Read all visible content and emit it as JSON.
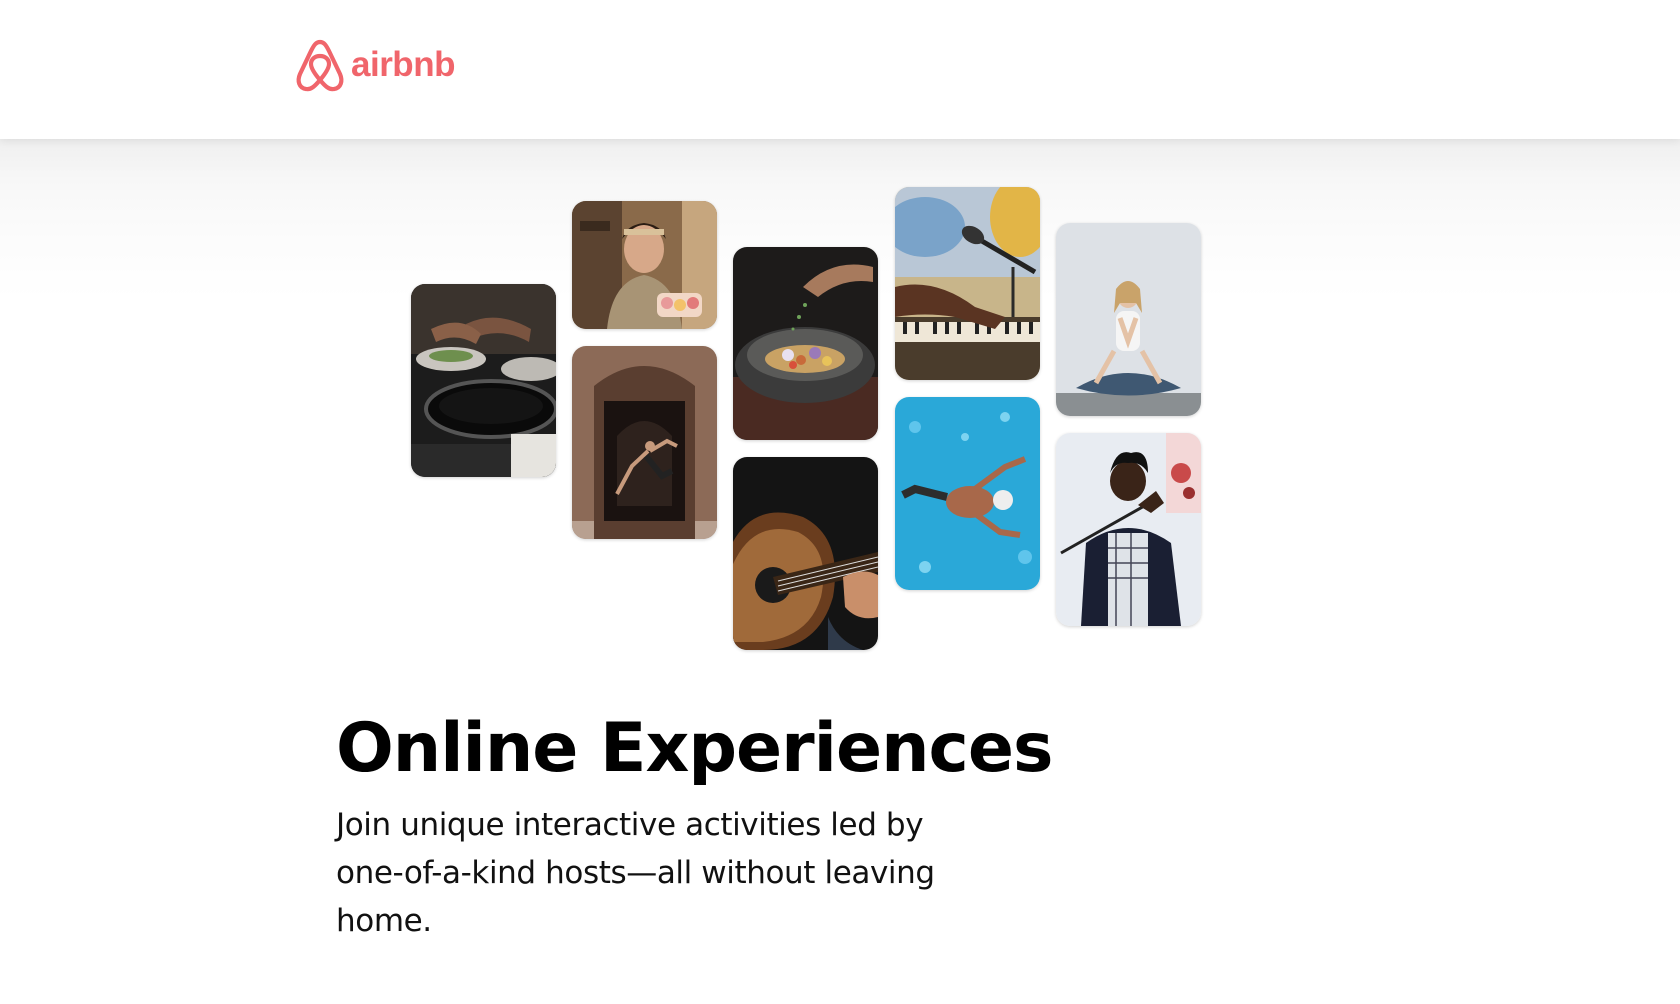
{
  "header": {
    "logo_text": "airbnb",
    "brand_color": "#F0656B"
  },
  "hero": {
    "title": "Online Experiences",
    "subtitle": "Join unique interactive activities led by one-of-a-kind hosts—all without leaving home."
  },
  "collage": {
    "photos": [
      {
        "name": "cooking-pans-photo"
      },
      {
        "name": "baker-holding-macarons-photo"
      },
      {
        "name": "dancer-in-doorway-photo"
      },
      {
        "name": "seasoning-bowl-photo"
      },
      {
        "name": "acoustic-guitar-photo"
      },
      {
        "name": "keyboard-and-microphone-photo"
      },
      {
        "name": "swimmer-in-pool-photo"
      },
      {
        "name": "meditation-yoga-photo"
      },
      {
        "name": "singer-with-microphone-photo"
      }
    ]
  }
}
